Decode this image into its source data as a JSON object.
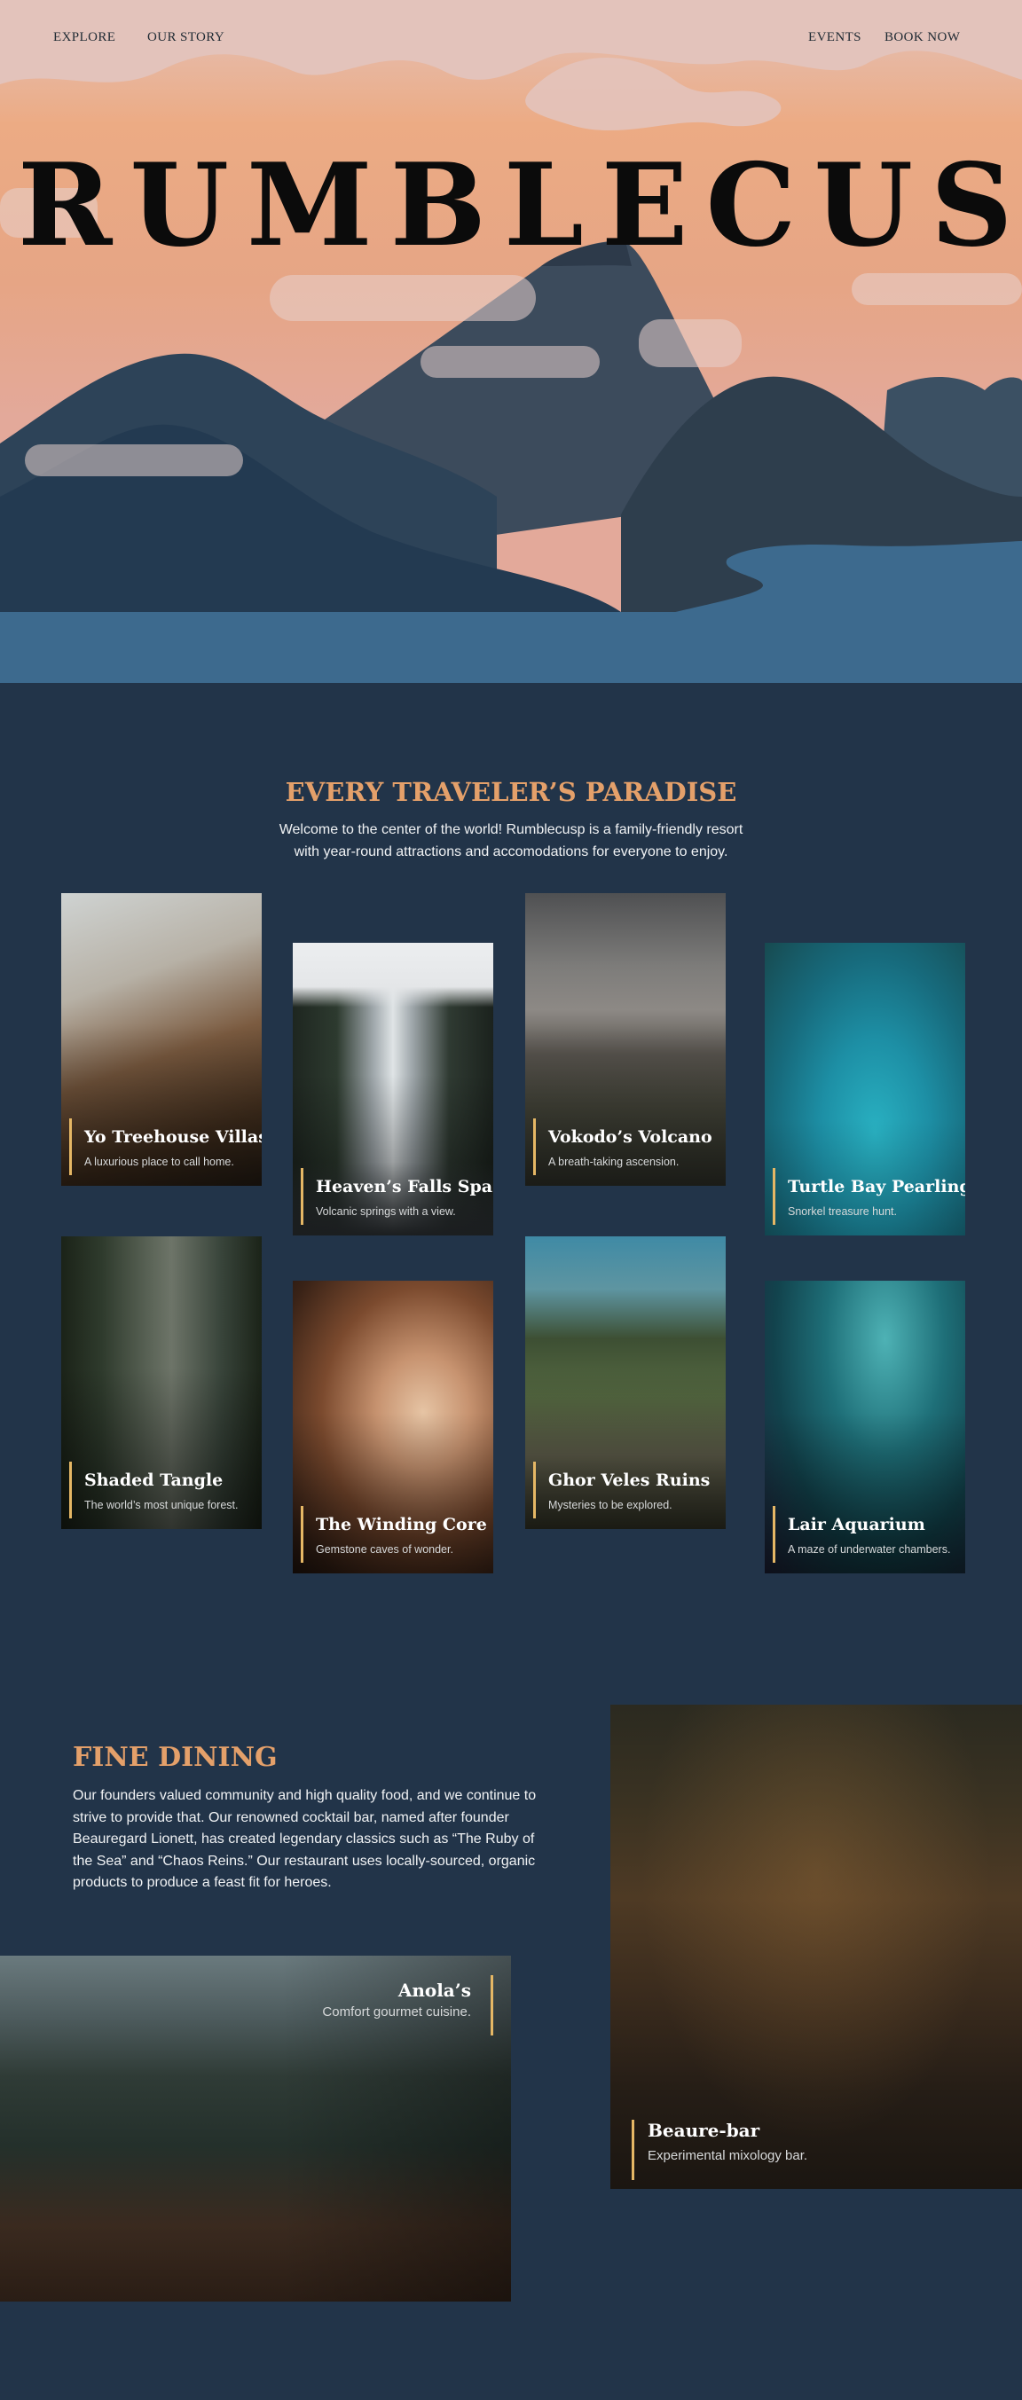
{
  "nav": {
    "left": [
      "EXPLORE",
      "OUR STORY"
    ],
    "right": [
      "EVENTS",
      "BOOK NOW"
    ]
  },
  "hero": {
    "title": "RUMBLECUSP"
  },
  "intro": {
    "title": "EVERY TRAVELER’S PARADISE",
    "text": "Welcome to the center of the world! Rumblecusp is a family-friendly resort with year-round attractions and accomodations for everyone to enjoy."
  },
  "attractions": [
    {
      "title": "Yo Treehouse Villas",
      "subtitle": "A luxurious place to call home."
    },
    {
      "title": "Heaven’s Falls Spa",
      "subtitle": "Volcanic springs with a view."
    },
    {
      "title": "Vokodo’s Volcano",
      "subtitle": "A breath-taking ascension."
    },
    {
      "title": "Turtle Bay Pearling",
      "subtitle": "Snorkel treasure hunt."
    },
    {
      "title": "Shaded Tangle",
      "subtitle": "The world’s most unique forest."
    },
    {
      "title": "The Winding Core",
      "subtitle": "Gemstone caves of wonder."
    },
    {
      "title": "Ghor Veles Ruins",
      "subtitle": "Mysteries to be explored."
    },
    {
      "title": "Lair Aquarium",
      "subtitle": "A maze of underwater chambers."
    }
  ],
  "dining": {
    "title": "FINE DINING",
    "text": "Our founders valued community and high quality food, and we continue to strive to provide that. Our renowned cocktail bar, named after founder Beauregard Lionett, has created legendary classics such as “The Ruby of the Sea” and “Chaos Reins.” Our restaurant uses locally-sourced, organic products to produce a feast fit for heroes.",
    "venues": [
      {
        "title": "Anola’s",
        "subtitle": "Comfort gourmet cuisine."
      },
      {
        "title": "Beaure-bar",
        "subtitle": "Experimental mixology bar."
      }
    ]
  },
  "colors": {
    "page_background": "#223449",
    "heading_accent": "#e4a06a",
    "card_accent_bar": "#e5b765",
    "hero_sky": "#eba987",
    "water": "#3d6a8e"
  },
  "icons": []
}
